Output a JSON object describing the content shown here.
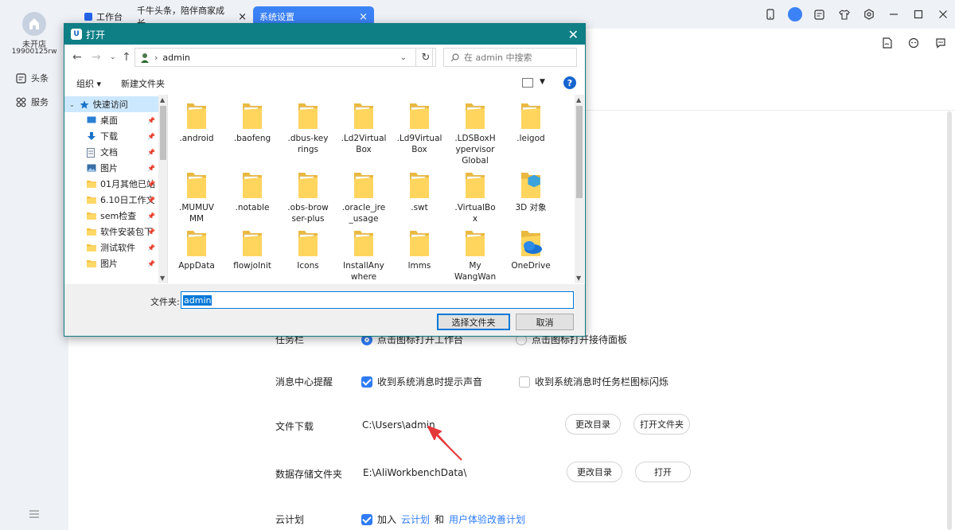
{
  "rail": {
    "shop_name": "未开店",
    "shop_phone": "19900125rw",
    "items": [
      {
        "label": "头条",
        "icon": "news-icon"
      },
      {
        "label": "服务",
        "icon": "grid-icon"
      }
    ],
    "menu_icon": "hamburger-icon"
  },
  "tabs": [
    {
      "label": "工作台",
      "icon": "home-icon"
    },
    {
      "label": "千牛头条，陪伴商家成长，..."
    },
    {
      "label": "系统设置",
      "active": true
    }
  ],
  "top_icons": [
    "phone-icon",
    "headset-icon",
    "notes-icon",
    "shirt-icon",
    "settings-icon",
    "minimize-icon",
    "maximize-icon",
    "close-icon"
  ],
  "sub_icons": [
    "doc-icon",
    "bot-icon",
    "chat-icon"
  ],
  "settings": {
    "taskbar": {
      "label": "任务栏",
      "option_a": "点击图标打开工作台",
      "option_b": "点击图标打开接待面板"
    },
    "message_center": {
      "label": "消息中心提醒",
      "option_a": "收到系统消息时提示声音",
      "option_b": "收到系统消息时任务栏图标闪烁"
    },
    "file_download": {
      "label": "文件下载",
      "path": "C:\\Users\\admin",
      "change_button": "更改目录",
      "open_button": "打开文件夹"
    },
    "data_storage": {
      "label": "数据存储文件夹",
      "path": "E:\\AliWorkbenchData\\",
      "change_button": "更改目录",
      "open_button": "打开"
    },
    "cloud_plan": {
      "label": "云计划",
      "join": "加入",
      "link1": "云计划",
      "and": "和",
      "link2": "用户体验改善计划"
    }
  },
  "dialog": {
    "title": "打开",
    "logo_letter": "U",
    "address": "admin",
    "search_placeholder": "在 admin 中搜索",
    "organize": "组织 ▾",
    "new_folder": "新建文件夹",
    "help": "?",
    "nav": [
      {
        "label": "快速访问",
        "type": "quick",
        "selected": true
      },
      {
        "label": "桌面",
        "type": "desktop"
      },
      {
        "label": "下载",
        "type": "download"
      },
      {
        "label": "文档",
        "type": "doc"
      },
      {
        "label": "图片",
        "type": "pic"
      },
      {
        "label": "01月其他已站",
        "type": "folder"
      },
      {
        "label": "6.10日工作文",
        "type": "folder"
      },
      {
        "label": "sem检查",
        "type": "folder"
      },
      {
        "label": "软件安装包下",
        "type": "folder"
      },
      {
        "label": "测试软件",
        "type": "folder"
      },
      {
        "label": "图片",
        "type": "folder"
      }
    ],
    "files": [
      [
        ".android"
      ],
      [
        ".baofeng"
      ],
      [
        ".dbus-key",
        "rings"
      ],
      [
        ".Ld2Virtual",
        "Box"
      ],
      [
        ".Ld9Virtual",
        "Box"
      ],
      [
        ".LDSBoxH",
        "ypervisor",
        "Global"
      ],
      [
        ".leigod"
      ],
      [
        ".MUMUV",
        "MM"
      ],
      [
        ".notable"
      ],
      [
        ".obs-brow",
        "ser-plus"
      ],
      [
        ".oracle_jre",
        "_usage"
      ],
      [
        ".swt"
      ],
      [
        ".VirtualBo",
        "x"
      ],
      [
        "3D 对象"
      ],
      [
        "AppData"
      ],
      [
        "flowjoInit"
      ],
      [
        "Icons"
      ],
      [
        "InstallAny",
        "where"
      ],
      [
        "lmms"
      ],
      [
        "My",
        "WangWan"
      ],
      [
        "OneDrive"
      ]
    ],
    "filename_label": "文件夹:",
    "filename_value": "admin",
    "select_button": "选择文件夹",
    "cancel_button": "取消"
  }
}
